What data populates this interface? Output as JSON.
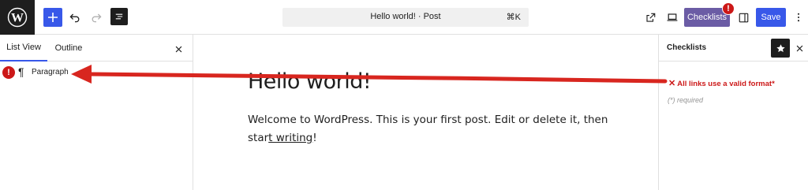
{
  "toolbar": {
    "undo_icon": "undo-icon",
    "redo_icon": "redo-icon",
    "add_icon": "plus-icon",
    "document_title": "Hello world! · Post",
    "command_shortcut": "⌘K",
    "checklists_label": "Checklists",
    "checklists_badge": "!",
    "save_label": "Save",
    "colors": {
      "accent": "#3858e9",
      "checklists": "#6b5ca5",
      "error": "#cc1818",
      "dark": "#1e1e1e"
    }
  },
  "left_panel": {
    "tabs": [
      {
        "label": "List View",
        "active": true
      },
      {
        "label": "Outline",
        "active": false
      }
    ],
    "rows": [
      {
        "error_badge": "!",
        "label": "Paragraph"
      }
    ]
  },
  "canvas": {
    "title": "Hello world!",
    "body_pre": "Welcome to WordPress. This is your first post. Edit or delete it, then star",
    "body_link": "t writing",
    "body_post": "!"
  },
  "right_panel": {
    "title": "Checklists",
    "items": [
      {
        "status": "fail",
        "mark": "✕",
        "label": "All links use a valid format*"
      }
    ],
    "required_note": "(*) required"
  }
}
